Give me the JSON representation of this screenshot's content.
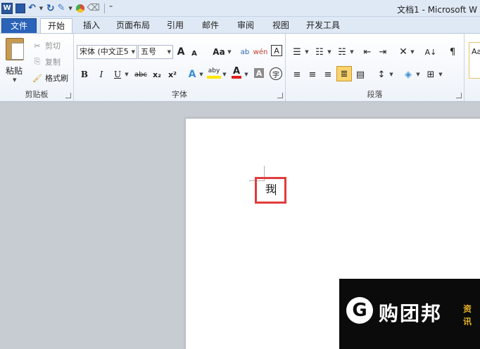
{
  "window": {
    "title": "文档1 - Microsoft W"
  },
  "qat": {
    "app_letter": "W",
    "more_glyph": "⁼"
  },
  "tabs": [
    "文件",
    "开始",
    "插入",
    "页面布局",
    "引用",
    "邮件",
    "审阅",
    "视图",
    "开发工具"
  ],
  "clipboard": {
    "paste": "粘贴",
    "cut": "剪切",
    "copy": "复制",
    "format_painter": "格式刷",
    "group_label": "剪贴板"
  },
  "font": {
    "font_name": "宋体 (中文正5",
    "font_size": "五号",
    "grow": "A",
    "shrink": "A",
    "change_case": "Aa",
    "clear": "ab",
    "phonetic": "wén",
    "border_char": "A",
    "bold": "B",
    "italic": "I",
    "underline": "U",
    "strike": "abc",
    "subscript": "x₂",
    "superscript": "x²",
    "text_effect": "A",
    "highlight": "aby",
    "font_color": "A",
    "char_shading": "A",
    "enclose": "字",
    "group_label": "字体"
  },
  "paragraph": {
    "group_label": "段落",
    "shading_glyph": "◈",
    "sort_glyph": "A↓",
    "marks_glyph": "¶"
  },
  "styles": {
    "label": "Aa"
  },
  "document": {
    "text": "我"
  },
  "watermark": {
    "logo_letter": "G",
    "brand": "购团邦",
    "sub1": "资",
    "sub2": "讯"
  },
  "colors": {
    "file_tab": "#2a63b8",
    "highlight_border": "#e23b3b",
    "accent": "#2b579a"
  }
}
